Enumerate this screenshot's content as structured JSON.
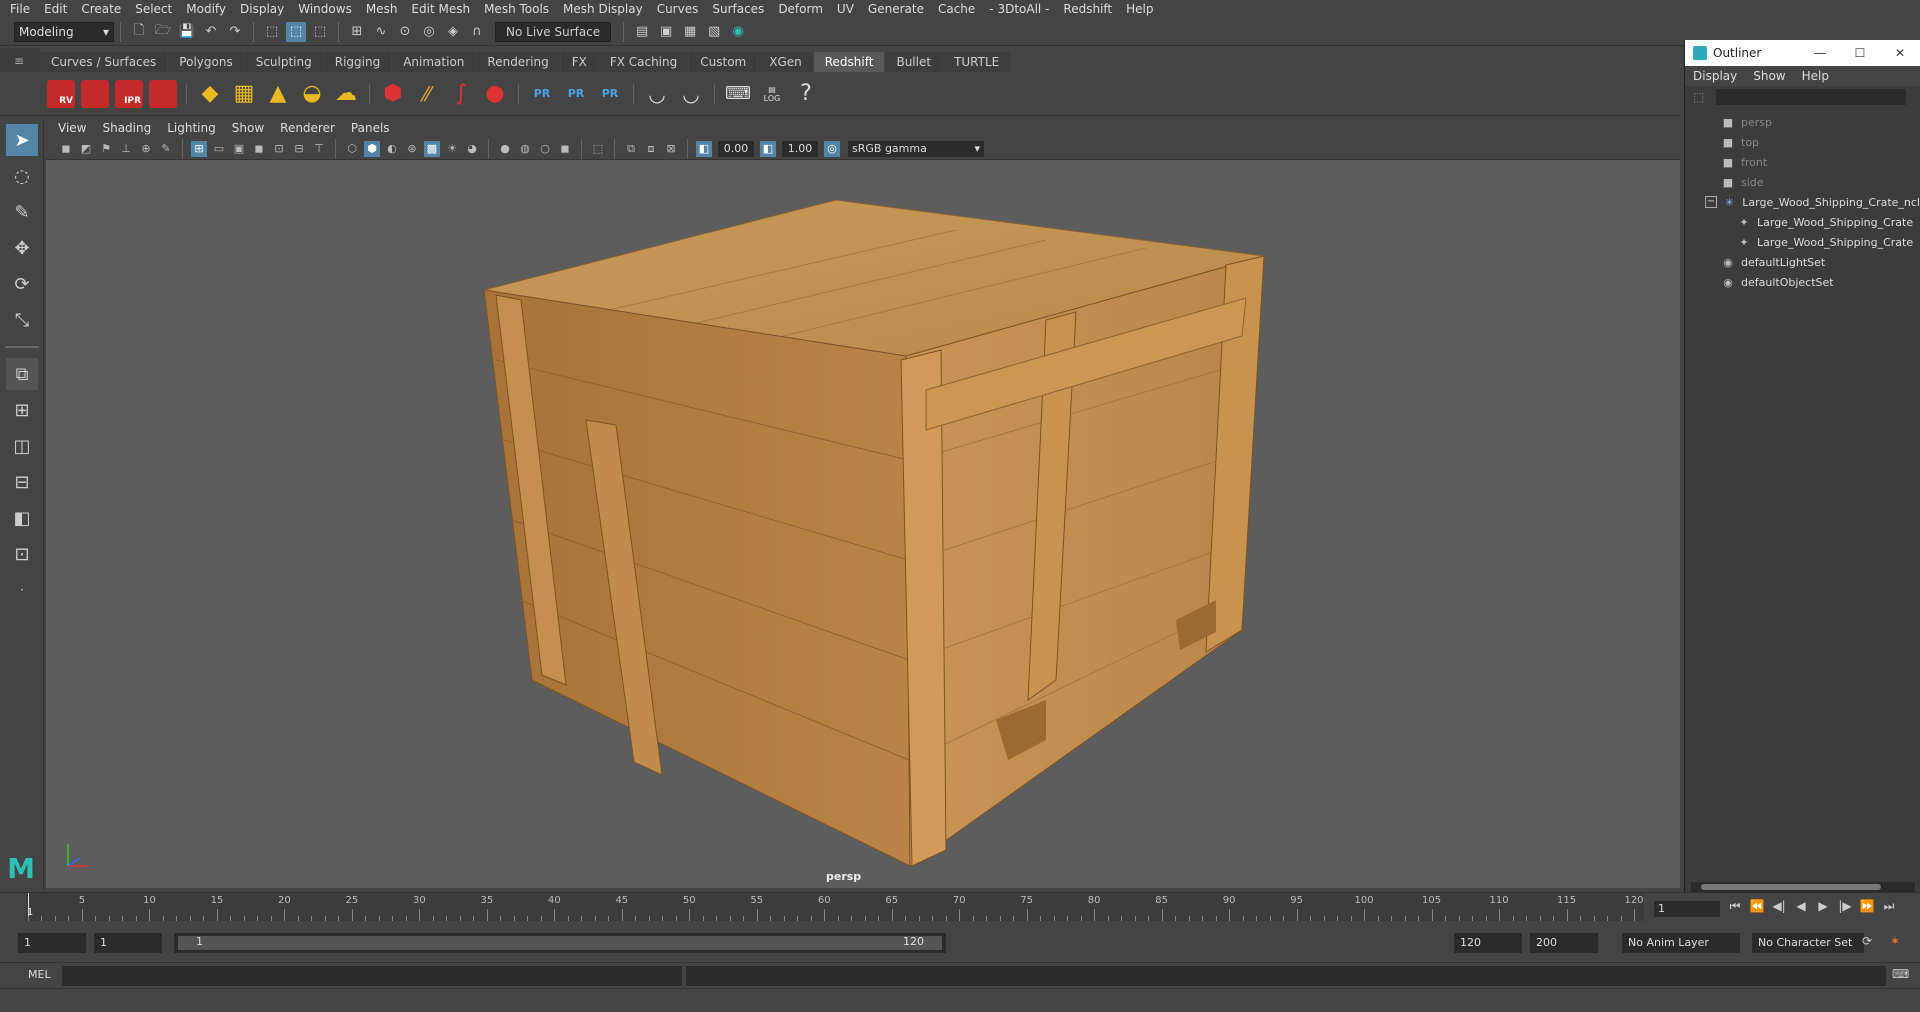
{
  "menubar": {
    "items": [
      "File",
      "Edit",
      "Create",
      "Select",
      "Modify",
      "Display",
      "Windows",
      "Mesh",
      "Edit Mesh",
      "Mesh Tools",
      "Mesh Display",
      "Curves",
      "Surfaces",
      "Deform",
      "UV",
      "Generate",
      "Cache",
      "- 3DtoAll -",
      "Redshift",
      "Help"
    ]
  },
  "statusline": {
    "mode": "Modeling",
    "live_surface": "No Live Surface"
  },
  "shelf": {
    "tabs": [
      "Curves / Surfaces",
      "Polygons",
      "Sculpting",
      "Rigging",
      "Animation",
      "Rendering",
      "FX",
      "FX Caching",
      "Custom",
      "XGen",
      "Redshift",
      "Bullet",
      "TURTLE"
    ],
    "active_tab": "Redshift",
    "buttons": {
      "rv": "RV",
      "ipr": "IPR",
      "pr": "PR",
      "log": "LOG"
    }
  },
  "panel": {
    "menus": [
      "View",
      "Shading",
      "Lighting",
      "Show",
      "Renderer",
      "Panels"
    ],
    "exposure": "0.00",
    "gamma": "1.00",
    "color_space": "sRGB gamma",
    "camera_label": "persp"
  },
  "outliner": {
    "title": "Outliner",
    "menus": [
      "Display",
      "Show",
      "Help"
    ],
    "rows": [
      {
        "label": "persp",
        "dim": true
      },
      {
        "label": "top",
        "dim": true
      },
      {
        "label": "front",
        "dim": true
      },
      {
        "label": "side",
        "dim": true
      },
      {
        "label": "Large_Wood_Shipping_Crate_ncl",
        "dim": false
      },
      {
        "label": "Large_Wood_Shipping_Crate",
        "dim": false
      },
      {
        "label": "Large_Wood_Shipping_Crate",
        "dim": false
      },
      {
        "label": "defaultLightSet",
        "dim": false
      },
      {
        "label": "defaultObjectSet",
        "dim": false
      }
    ]
  },
  "timeslider": {
    "ticks": [
      5,
      10,
      15,
      20,
      25,
      30,
      35,
      40,
      45,
      50,
      55,
      60,
      65,
      70,
      75,
      80,
      85,
      90,
      95,
      100,
      105,
      110,
      115,
      120
    ],
    "start_marker": "1",
    "current_frame": "1"
  },
  "rangeslider": {
    "start": "1",
    "playback_start": "1",
    "range_start": "1",
    "range_end": "120",
    "playback_end": "120",
    "end": "200",
    "anim_layer": "No Anim Layer",
    "character_set": "No Character Set"
  },
  "cmdline": {
    "language": "MEL"
  }
}
